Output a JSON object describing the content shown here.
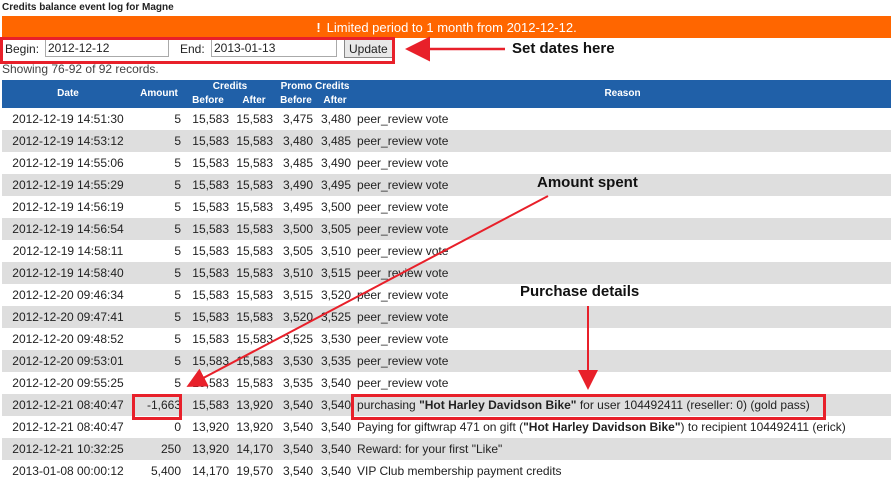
{
  "page": {
    "title": "Credits balance event log for Magne"
  },
  "banner": {
    "icon": "warning-exclamation-icon",
    "icon_glyph": "!",
    "text": "Limited period to 1 month from 2012-12-12."
  },
  "filter": {
    "begin_label": "Begin:",
    "begin_value": "2012-12-12",
    "end_label": "End:",
    "end_value": "2013-01-13",
    "update_label": "Update"
  },
  "showing_text": "Showing 76-92 of 92 records.",
  "annotations": {
    "set_dates": "Set dates here",
    "amount_spent": "Amount spent",
    "purchase_details": "Purchase details"
  },
  "table": {
    "headers": {
      "date": "Date",
      "amount": "Amount",
      "credits": "Credits",
      "promo_credits": "Promo Credits",
      "before": "Before",
      "after": "After",
      "reason": "Reason"
    },
    "rows": [
      {
        "date": "2012-12-19 14:51:30",
        "amount": "5",
        "cb": "15,583",
        "ca": "15,583",
        "pb": "3,475",
        "pa": "3,480",
        "reason": "peer_review vote"
      },
      {
        "date": "2012-12-19 14:53:12",
        "amount": "5",
        "cb": "15,583",
        "ca": "15,583",
        "pb": "3,480",
        "pa": "3,485",
        "reason": "peer_review vote"
      },
      {
        "date": "2012-12-19 14:55:06",
        "amount": "5",
        "cb": "15,583",
        "ca": "15,583",
        "pb": "3,485",
        "pa": "3,490",
        "reason": "peer_review vote"
      },
      {
        "date": "2012-12-19 14:55:29",
        "amount": "5",
        "cb": "15,583",
        "ca": "15,583",
        "pb": "3,490",
        "pa": "3,495",
        "reason": "peer_review vote"
      },
      {
        "date": "2012-12-19 14:56:19",
        "amount": "5",
        "cb": "15,583",
        "ca": "15,583",
        "pb": "3,495",
        "pa": "3,500",
        "reason": "peer_review vote"
      },
      {
        "date": "2012-12-19 14:56:54",
        "amount": "5",
        "cb": "15,583",
        "ca": "15,583",
        "pb": "3,500",
        "pa": "3,505",
        "reason": "peer_review vote"
      },
      {
        "date": "2012-12-19 14:58:11",
        "amount": "5",
        "cb": "15,583",
        "ca": "15,583",
        "pb": "3,505",
        "pa": "3,510",
        "reason": "peer_review vote"
      },
      {
        "date": "2012-12-19 14:58:40",
        "amount": "5",
        "cb": "15,583",
        "ca": "15,583",
        "pb": "3,510",
        "pa": "3,515",
        "reason": "peer_review vote"
      },
      {
        "date": "2012-12-20 09:46:34",
        "amount": "5",
        "cb": "15,583",
        "ca": "15,583",
        "pb": "3,515",
        "pa": "3,520",
        "reason": "peer_review vote"
      },
      {
        "date": "2012-12-20 09:47:41",
        "amount": "5",
        "cb": "15,583",
        "ca": "15,583",
        "pb": "3,520",
        "pa": "3,525",
        "reason": "peer_review vote"
      },
      {
        "date": "2012-12-20 09:48:52",
        "amount": "5",
        "cb": "15,583",
        "ca": "15,583",
        "pb": "3,525",
        "pa": "3,530",
        "reason": "peer_review vote"
      },
      {
        "date": "2012-12-20 09:53:01",
        "amount": "5",
        "cb": "15,583",
        "ca": "15,583",
        "pb": "3,530",
        "pa": "3,535",
        "reason": "peer_review vote"
      },
      {
        "date": "2012-12-20 09:55:25",
        "amount": "5",
        "cb": "15,583",
        "ca": "15,583",
        "pb": "3,535",
        "pa": "3,540",
        "reason": "peer_review vote"
      },
      {
        "date": "2012-12-21 08:40:47",
        "amount": "-1,663",
        "cb": "15,583",
        "ca": "13,920",
        "pb": "3,540",
        "pa": "3,540",
        "reason_pre": "purchasing ",
        "reason_bold": "\"Hot Harley Davidson Bike\"",
        "reason_post": " for user 104492411 (reseller: 0) (gold pass)"
      },
      {
        "date": "2012-12-21 08:40:47",
        "amount": "0",
        "cb": "13,920",
        "ca": "13,920",
        "pb": "3,540",
        "pa": "3,540",
        "reason_pre": "Paying for giftwrap 471 on gift (",
        "reason_bold": "\"Hot Harley Davidson Bike\"",
        "reason_post": ") to recipient 104492411 (erick)"
      },
      {
        "date": "2012-12-21 10:32:25",
        "amount": "250",
        "cb": "13,920",
        "ca": "14,170",
        "pb": "3,540",
        "pa": "3,540",
        "reason": "Reward: for your first \"Like\""
      },
      {
        "date": "2013-01-08 00:00:12",
        "amount": "5,400",
        "cb": "14,170",
        "ca": "19,570",
        "pb": "3,540",
        "pa": "3,540",
        "reason": "VIP Club membership payment credits"
      }
    ]
  },
  "colors": {
    "banner": "#ff6600",
    "header": "#2060a8",
    "highlight": "#e8202a",
    "stripe": "#dedede"
  }
}
